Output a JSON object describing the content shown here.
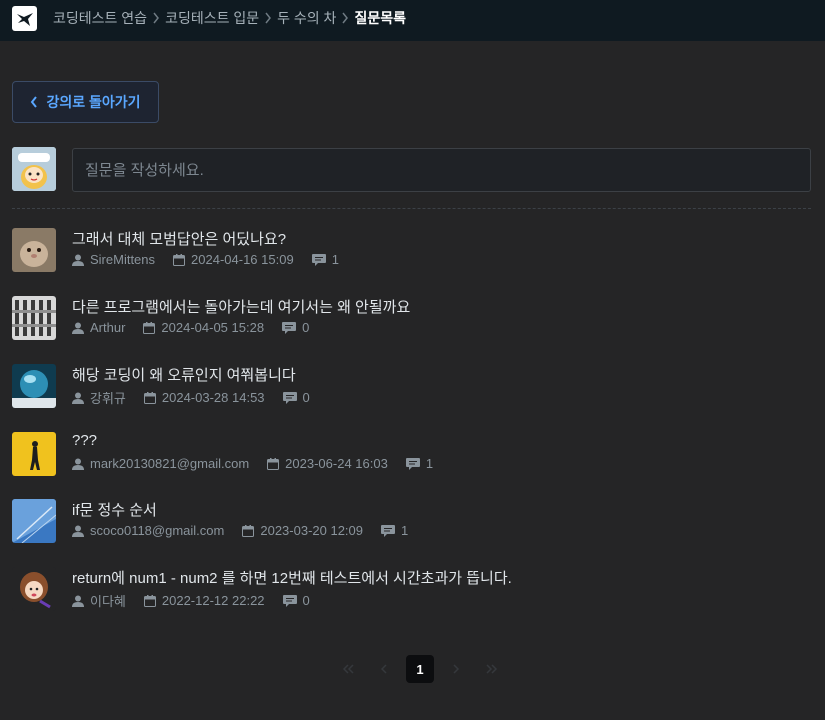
{
  "breadcrumb": {
    "items": [
      "코딩테스트 연습",
      "코딩테스트 입문",
      "두 수의 차"
    ],
    "current": "질문목록"
  },
  "back_button": {
    "label": "강의로 돌아가기"
  },
  "question_input": {
    "placeholder": "질문을 작성하세요."
  },
  "questions": [
    {
      "title": "그래서 대체 모범답안은 어딨나요?",
      "author": "SireMittens",
      "date": "2024-04-16 15:09",
      "comments": "1"
    },
    {
      "title": "다른 프로그램에서는 돌아가는데 여기서는 왜 안될까요",
      "author": "Arthur",
      "date": "2024-04-05 15:28",
      "comments": "0"
    },
    {
      "title": "해당 코딩이 왜 오류인지 여쭤봅니다",
      "author": "강휘규",
      "date": "2024-03-28 14:53",
      "comments": "0"
    },
    {
      "title": "???",
      "author": "mark20130821@gmail.com",
      "date": "2023-06-24 16:03",
      "comments": "1"
    },
    {
      "title": "if문 정수 순서",
      "author": "scoco0118@gmail.com",
      "date": "2023-03-20 12:09",
      "comments": "1"
    },
    {
      "title": "return에 num1 - num2 를 하면 12번째 테스트에서 시간초과가 뜹니다.",
      "author": "이다혜",
      "date": "2022-12-12 22:22",
      "comments": "0"
    }
  ],
  "pagination": {
    "current": "1"
  },
  "colors": {
    "accent": "#5aa7ff",
    "background": "#252526",
    "topbar": "#0f1a21"
  }
}
